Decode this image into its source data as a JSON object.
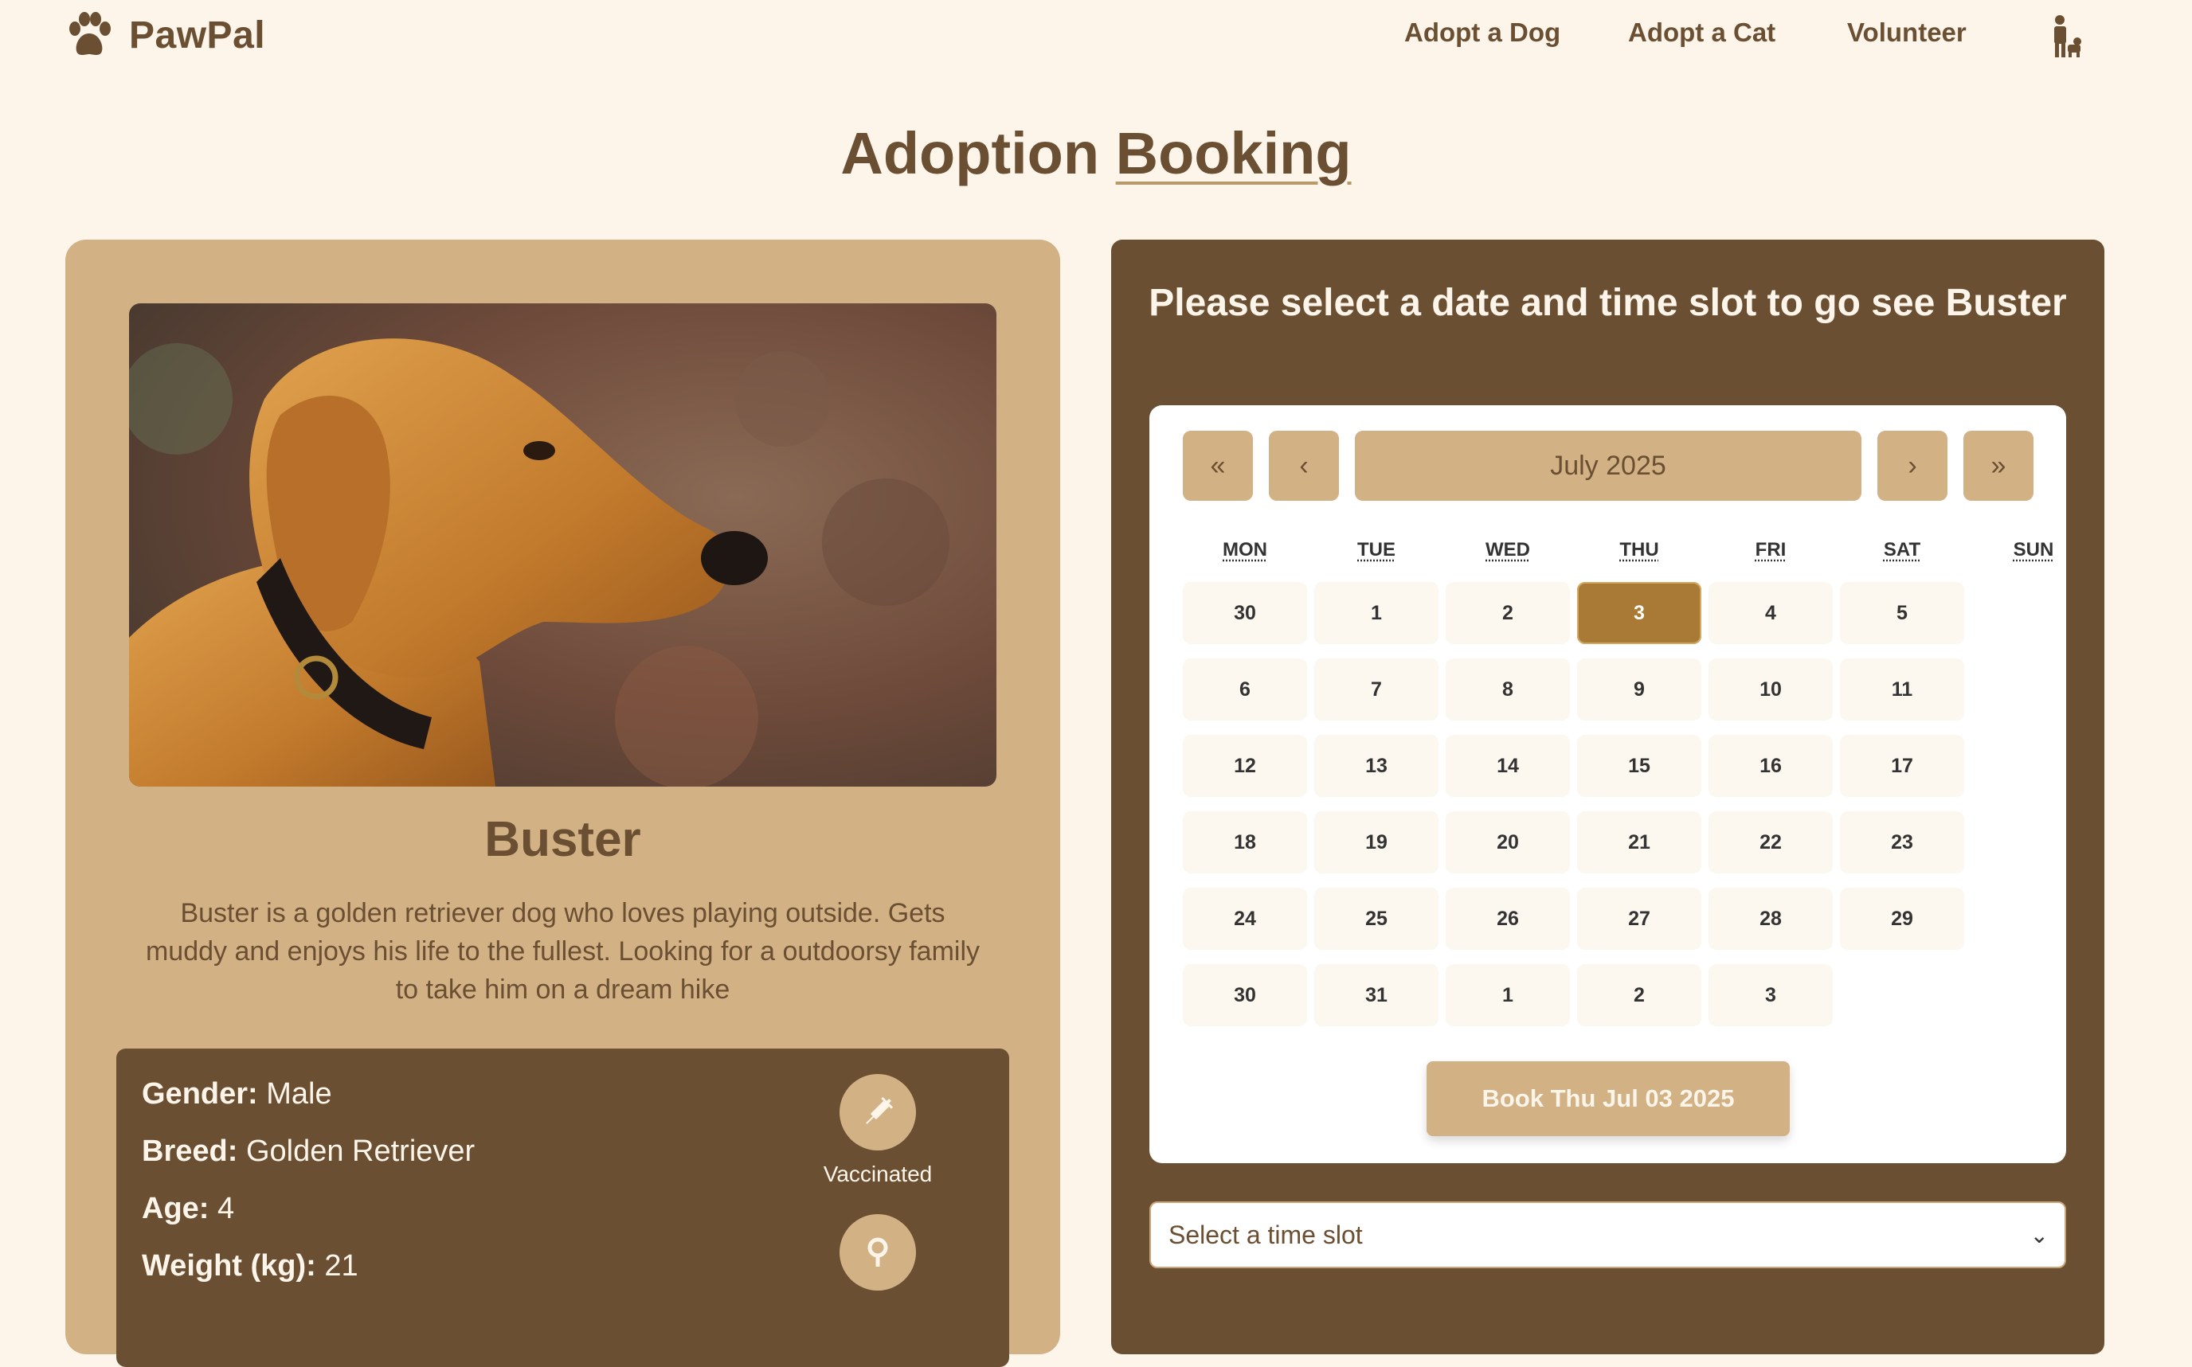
{
  "brand": {
    "name": "PawPal",
    "icon": "paw-icon"
  },
  "nav": {
    "links": [
      "Adopt a Dog",
      "Adopt a Cat",
      "Volunteer"
    ],
    "user_icon": "person-with-dog-icon"
  },
  "page_title": {
    "main": "Adoption",
    "underlined": "Booking"
  },
  "pet": {
    "name": "Buster",
    "description": "Buster is a golden retriever dog who loves playing outside. Gets muddy and enjoys his life to the fullest. Looking for a outdoorsy family to take him on a dream hike",
    "photo": "golden-retriever-photo",
    "details": [
      {
        "label": "Gender:",
        "value": "Male"
      },
      {
        "label": "Breed:",
        "value": "Golden Retriever"
      },
      {
        "label": "Age:",
        "value": "4"
      },
      {
        "label": "Weight (kg):",
        "value": "21"
      }
    ],
    "badges": [
      {
        "icon": "syringe-icon",
        "label": "Vaccinated"
      },
      {
        "icon": "neutered-icon",
        "label": ""
      }
    ]
  },
  "booking": {
    "heading": "Please select a date and time slot to go see Buster",
    "calendar": {
      "prev_year": "«",
      "prev_month": "‹",
      "month_label": "July 2025",
      "next_month": "›",
      "next_year": "»",
      "weekdays": [
        "MON",
        "TUE",
        "WED",
        "THU",
        "FRI",
        "SAT",
        "SUN"
      ],
      "weeks": [
        [
          "30",
          "1",
          "2",
          "3",
          "4",
          "5"
        ],
        [
          "6",
          "7",
          "8",
          "9",
          "10",
          "11"
        ],
        [
          "12",
          "13",
          "14",
          "15",
          "16",
          "17"
        ],
        [
          "18",
          "19",
          "20",
          "21",
          "22",
          "23"
        ],
        [
          "24",
          "25",
          "26",
          "27",
          "28",
          "29"
        ],
        [
          "30",
          "31",
          "1",
          "2",
          "3"
        ]
      ],
      "selected": "3"
    },
    "book_button": "Book Thu Jul 03 2025",
    "time_slot": {
      "placeholder": "Select a time slot"
    }
  },
  "colors": {
    "background": "#fdf5e9",
    "brown": "#6b4f33",
    "tan": "#d2b185",
    "selected_day": "#a97a35"
  }
}
